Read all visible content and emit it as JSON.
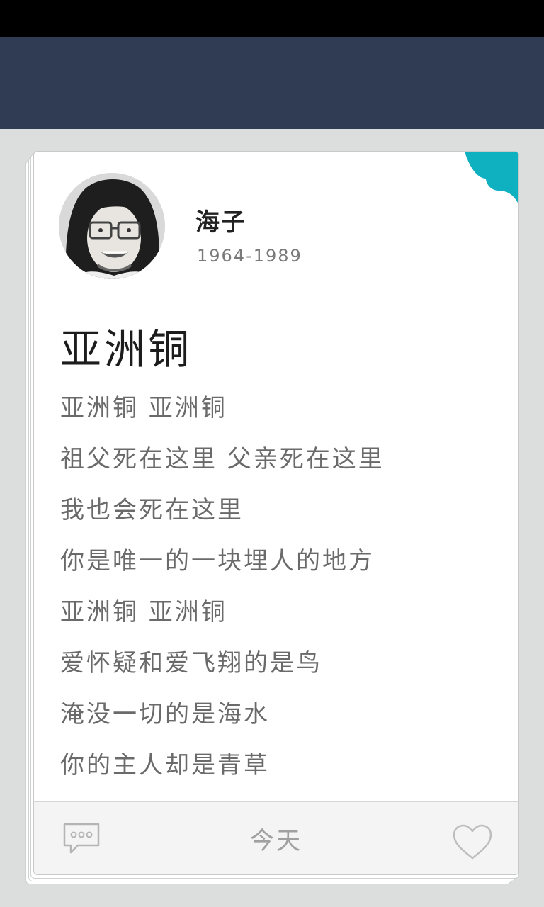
{
  "author": {
    "name": "海子",
    "years": "1964-1989"
  },
  "poem": {
    "title": "亚洲铜",
    "lines": [
      "亚洲铜 亚洲铜",
      "祖父死在这里 父亲死在这里",
      "我也会死在这里",
      "你是唯一的一块埋人的地方",
      "亚洲铜 亚洲铜",
      "爱怀疑和爱飞翔的是鸟",
      "淹没一切的是海水",
      "你的主人却是青草"
    ]
  },
  "footer": {
    "date_label": "今天",
    "comment_icon": "comment-icon",
    "like_icon": "heart-icon"
  },
  "colors": {
    "header": "#2f3c54",
    "accent": "#0fb0c0",
    "background": "#dcdedd"
  }
}
